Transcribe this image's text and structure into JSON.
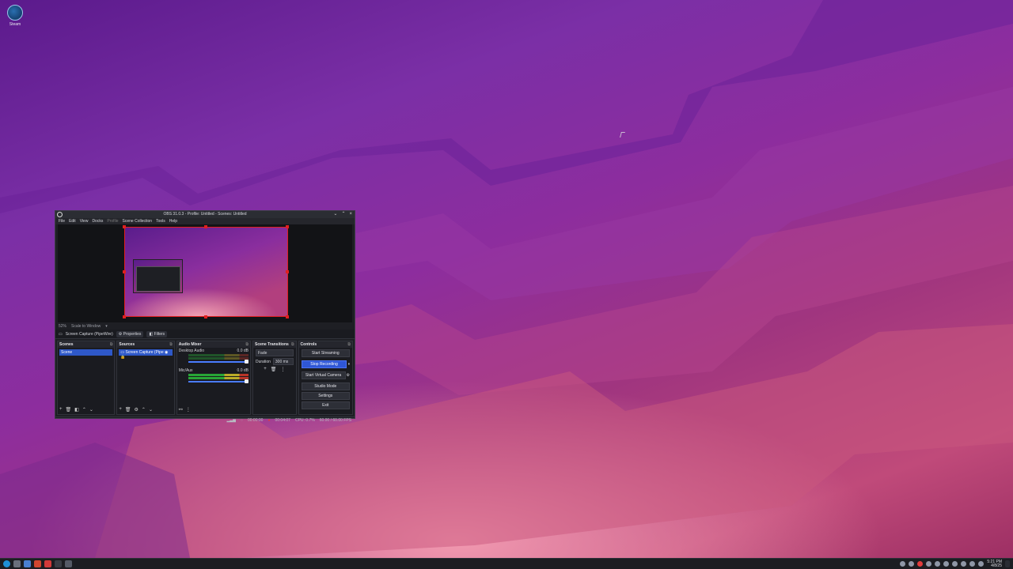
{
  "desktop": {
    "icons": [
      {
        "label": "Steam",
        "icon": "steam-icon"
      }
    ]
  },
  "obs": {
    "title": "OBS 31.0.3 - Profile: Untitled - Scenes: Untitled",
    "menu": [
      "File",
      "Edit",
      "View",
      "Docks",
      "Profile",
      "Scene Collection",
      "Tools",
      "Help"
    ],
    "preview_status": {
      "zoom": "52%",
      "scale_mode": "Scale to Window"
    },
    "source_toolbar": {
      "source": "Screen Capture (PipeWire)",
      "properties": "Properties",
      "filters": "Filters"
    },
    "docks": {
      "scenes": {
        "title": "Scenes",
        "items": [
          "Scene"
        ]
      },
      "sources": {
        "title": "Sources",
        "items": [
          "Screen Capture (Pipe"
        ]
      },
      "audio_mixer": {
        "title": "Audio Mixer",
        "channels": [
          {
            "name": "Desktop Audio",
            "db": "0.0 dB"
          },
          {
            "name": "Mic/Aux",
            "db": "0.0 dB"
          }
        ]
      },
      "scene_transitions": {
        "title": "Scene Transitions",
        "transition": "Fade",
        "duration_label": "Duration",
        "duration_value": "300 ms"
      },
      "controls": {
        "title": "Controls",
        "buttons": [
          "Start Streaming",
          "Stop Recording",
          "Start Virtual Camera",
          "Studio Mode",
          "Settings",
          "Exit"
        ]
      }
    },
    "statusbar": {
      "stream_time": "00:00:00",
      "rec_time": "00:04:07",
      "cpu": "CPU: 0.7%",
      "fps": "60.00 / 60.00 FPS"
    }
  },
  "taskbar": {
    "clock_time": "5:21 PM",
    "clock_date": "4/8/25",
    "colors": {
      "bar": "#1c1d22",
      "accent": "#2f57d6",
      "rec": "#e23c3c"
    }
  }
}
